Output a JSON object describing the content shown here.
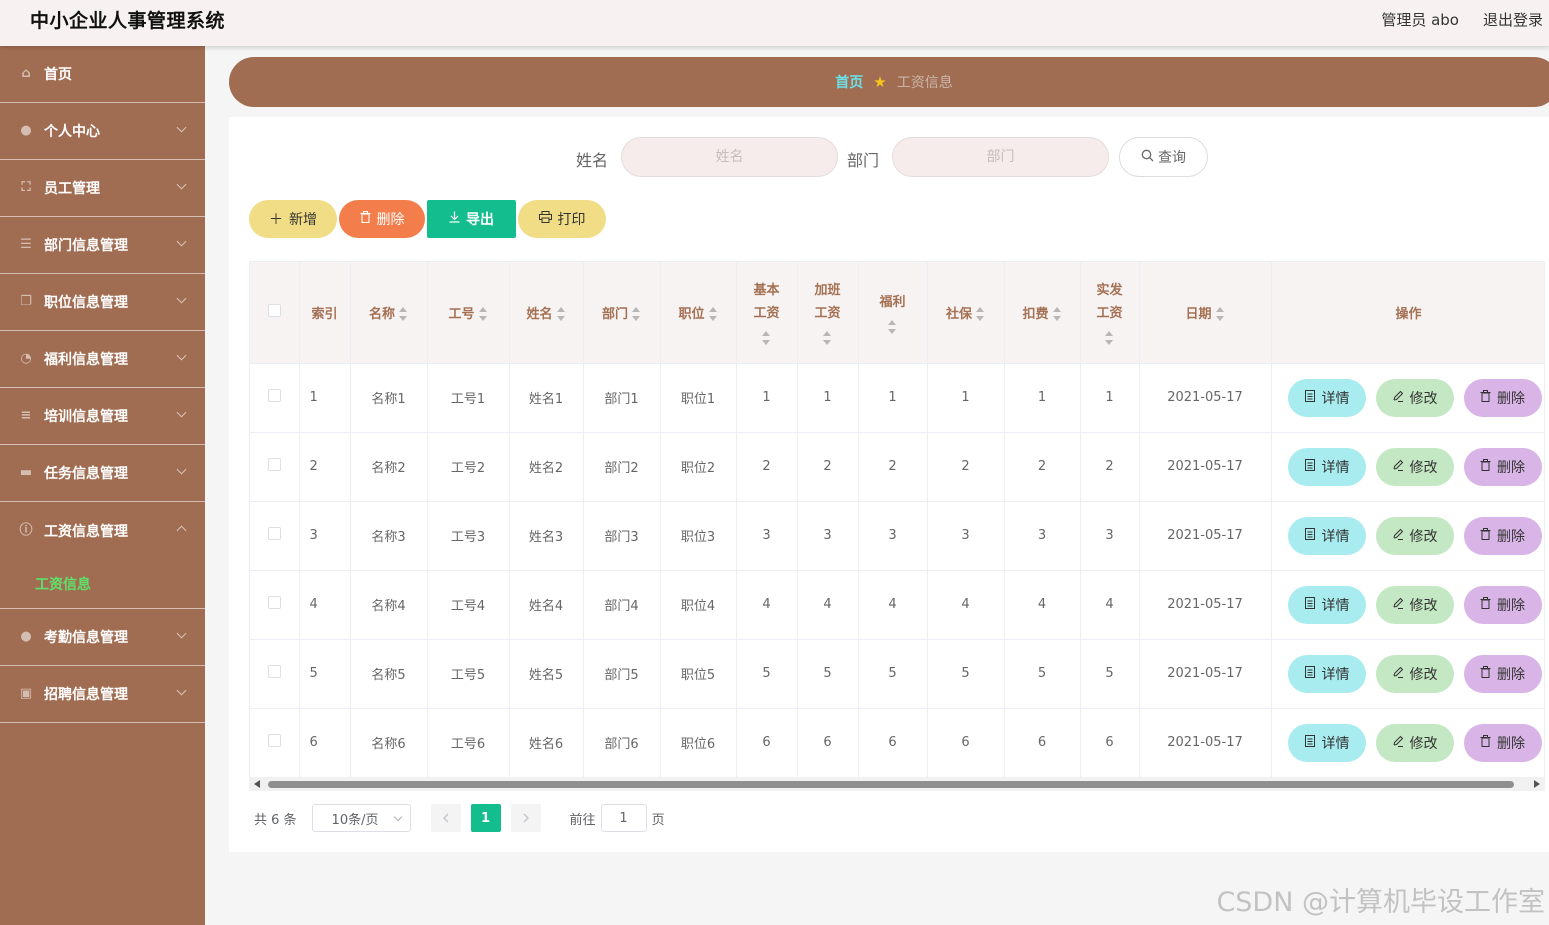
{
  "app": {
    "title": "中小企业人事管理系统",
    "user_label": "管理员 abo",
    "logout_label": "退出登录"
  },
  "sidebar": {
    "items": [
      {
        "label": "首页",
        "icon": "home-icon"
      },
      {
        "label": "个人中心",
        "icon": "user-icon"
      },
      {
        "label": "员工管理",
        "icon": "frame-icon"
      },
      {
        "label": "部门信息管理",
        "icon": "sliders-icon"
      },
      {
        "label": "职位信息管理",
        "icon": "copy-icon"
      },
      {
        "label": "福利信息管理",
        "icon": "clock-icon"
      },
      {
        "label": "培训信息管理",
        "icon": "list-icon"
      },
      {
        "label": "任务信息管理",
        "icon": "box-icon"
      },
      {
        "label": "工资信息管理",
        "icon": "info-icon",
        "open": true
      },
      {
        "label": "考勤信息管理",
        "icon": "user-icon"
      },
      {
        "label": "招聘信息管理",
        "icon": "chart-icon"
      }
    ],
    "sub_item": "工资信息",
    "active_color": "#5ee06a",
    "bg_color": "#a16d52"
  },
  "breadcrumb": {
    "home": "首页",
    "current": "工资信息"
  },
  "search": {
    "name_label": "姓名",
    "name_placeholder": "姓名",
    "dept_label": "部门",
    "dept_placeholder": "部门",
    "query_label": "查询"
  },
  "actions": {
    "add": "新增",
    "delete": "删除",
    "export": "导出",
    "print": "打印"
  },
  "table": {
    "columns": [
      "索引",
      "名称",
      "工号",
      "姓名",
      "部门",
      "职位",
      "基本工资",
      "加班工资",
      "福利",
      "社保",
      "扣费",
      "实发工资",
      "日期",
      "操作"
    ],
    "rows": [
      [
        "1",
        "名称1",
        "工号1",
        "姓名1",
        "部门1",
        "职位1",
        "1",
        "1",
        "1",
        "1",
        "1",
        "1",
        "2021-05-17"
      ],
      [
        "2",
        "名称2",
        "工号2",
        "姓名2",
        "部门2",
        "职位2",
        "2",
        "2",
        "2",
        "2",
        "2",
        "2",
        "2021-05-17"
      ],
      [
        "3",
        "名称3",
        "工号3",
        "姓名3",
        "部门3",
        "职位3",
        "3",
        "3",
        "3",
        "3",
        "3",
        "3",
        "2021-05-17"
      ],
      [
        "4",
        "名称4",
        "工号4",
        "姓名4",
        "部门4",
        "职位4",
        "4",
        "4",
        "4",
        "4",
        "4",
        "4",
        "2021-05-17"
      ],
      [
        "5",
        "名称5",
        "工号5",
        "姓名5",
        "部门5",
        "职位5",
        "5",
        "5",
        "5",
        "5",
        "5",
        "5",
        "2021-05-17"
      ],
      [
        "6",
        "名称6",
        "工号6",
        "姓名6",
        "部门6",
        "职位6",
        "6",
        "6",
        "6",
        "6",
        "6",
        "6",
        "2021-05-17"
      ]
    ],
    "row_actions": {
      "detail": "详情",
      "edit": "修改",
      "remove": "删除"
    }
  },
  "pagination": {
    "total": "共 6 条",
    "page_size": "10条/页",
    "current_page": "1",
    "goto_prefix": "前往",
    "goto_value": "1",
    "goto_suffix": "页"
  },
  "watermark": "CSDN @计算机毕设工作室",
  "colors": {
    "accent": "#13bd8d",
    "brand": "#a16d52",
    "header_text": "#a57154"
  }
}
